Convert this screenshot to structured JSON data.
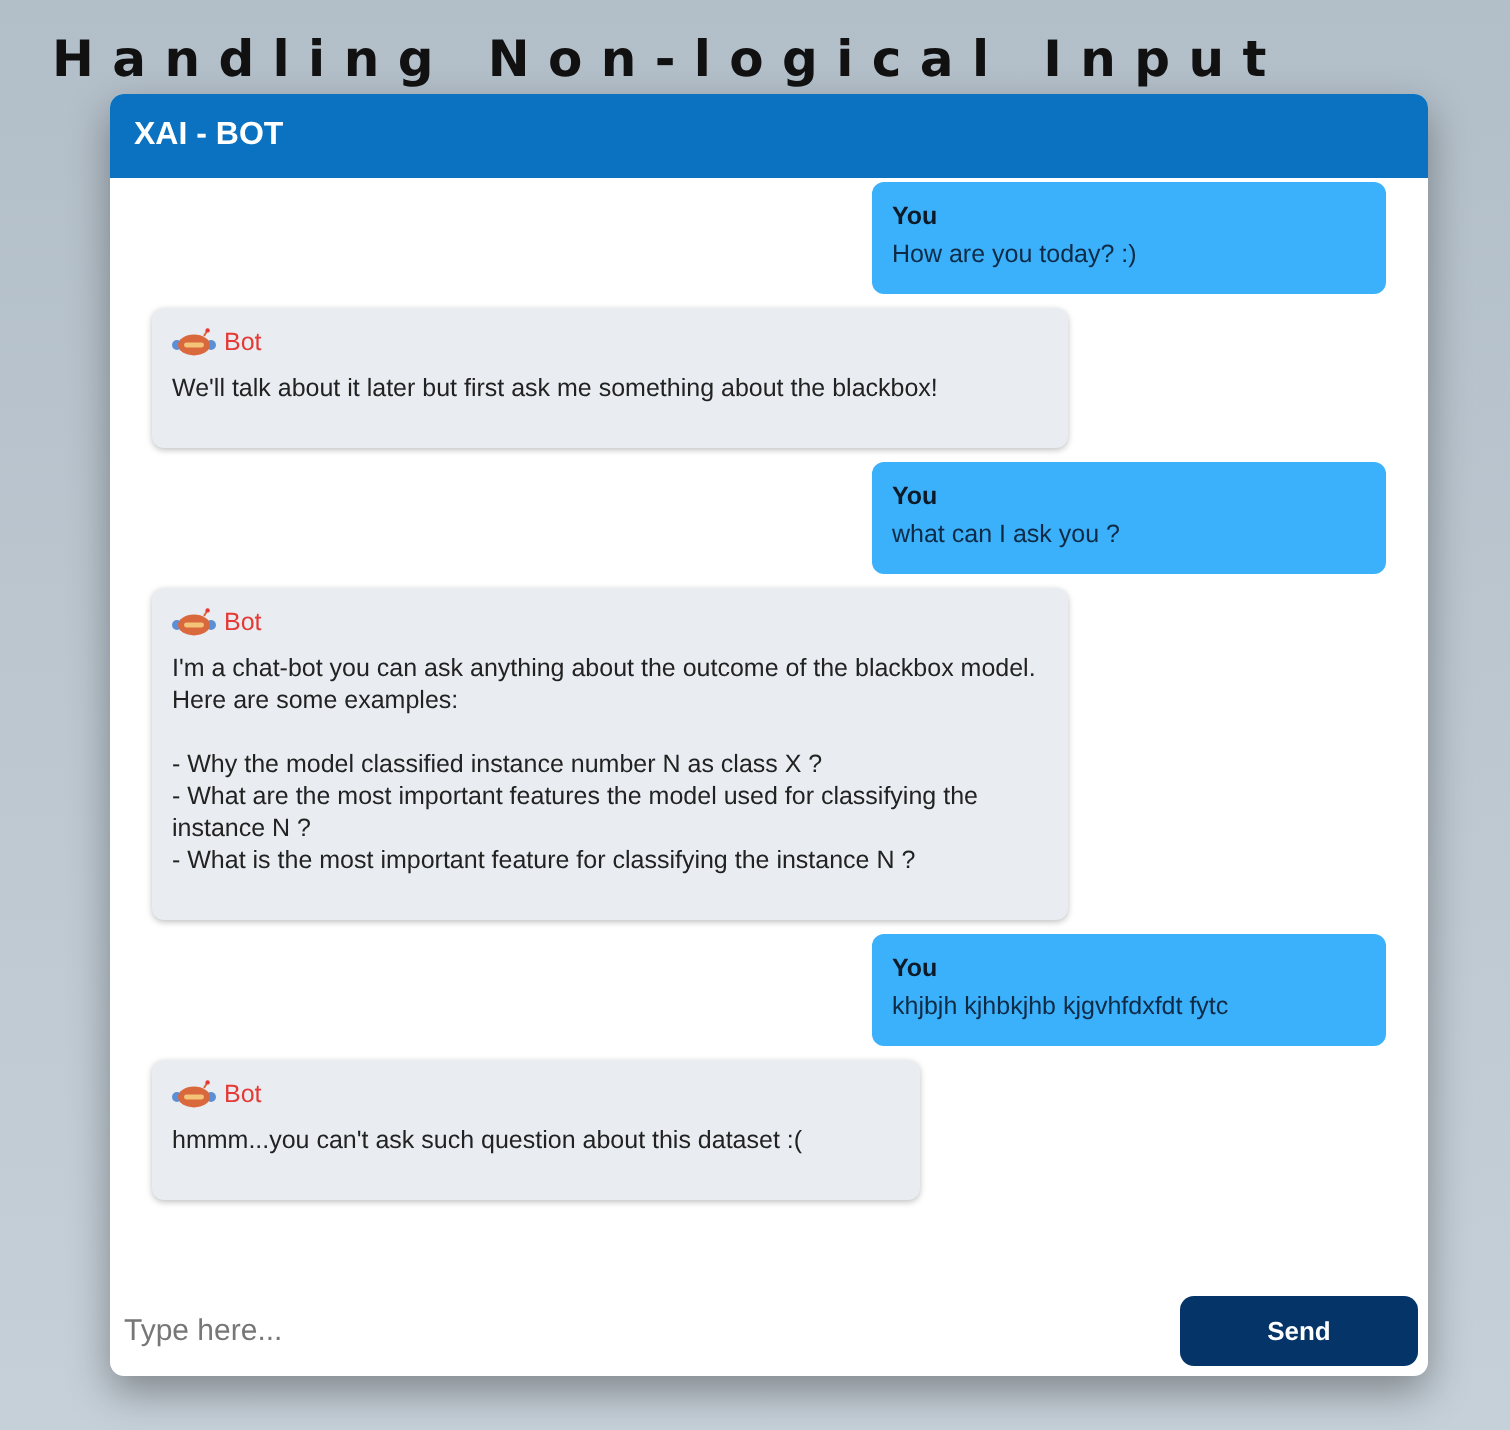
{
  "heading": "Handling Non-logical Input",
  "window": {
    "title": "XAI - BOT"
  },
  "messages": [
    {
      "kind": "user",
      "sender": "You",
      "text": "How are you today? :)"
    },
    {
      "kind": "bot",
      "sender": "Bot",
      "text": "We'll talk about it later but first ask me something about the blackbox!"
    },
    {
      "kind": "user",
      "sender": "You",
      "text": "what can I ask you ?"
    },
    {
      "kind": "bot",
      "sender": "Bot",
      "text": "I'm a chat-bot you can ask anything about the outcome of the blackbox model. Here are some examples:\n\n- Why the model classified instance number N as class X ?\n- What are the most important features the model used for classifying the instance N ?\n- What is the most important feature for classifying the instance N ?"
    },
    {
      "kind": "user",
      "sender": "You",
      "text": "khjbjh kjhbkjhb kjgvhfdxfdt fytc"
    },
    {
      "kind": "bot",
      "sender": "Bot",
      "text": "hmmm...you can't ask such question about this dataset :("
    }
  ],
  "input": {
    "placeholder": "Type here..."
  },
  "send_button": "Send"
}
